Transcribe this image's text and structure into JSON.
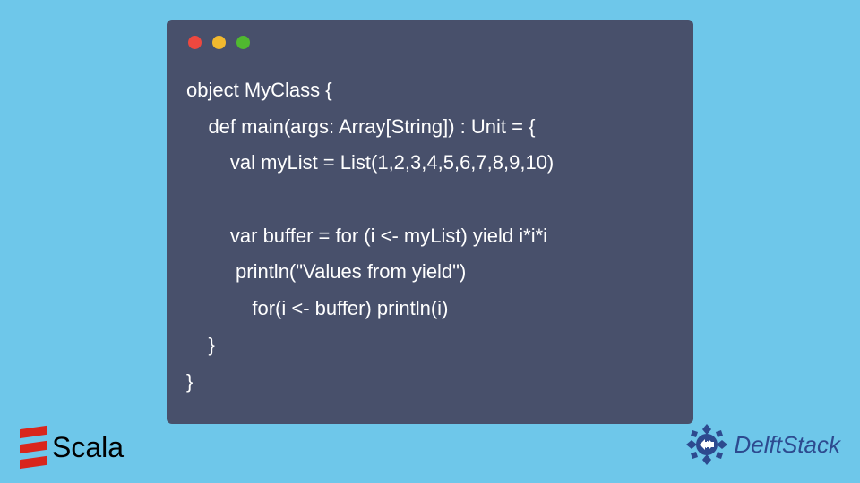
{
  "code": {
    "lines": [
      "object MyClass {",
      "    def main(args: Array[String]) : Unit = {",
      "        val myList = List(1,2,3,4,5,6,7,8,9,10)",
      "",
      "        var buffer = for (i <- myList) yield i*i*i",
      "         println(\"Values from yield\")",
      "            for(i <- buffer) println(i)",
      "    }",
      "}"
    ]
  },
  "logos": {
    "scala": "Scala",
    "delft": "DelftStack"
  }
}
